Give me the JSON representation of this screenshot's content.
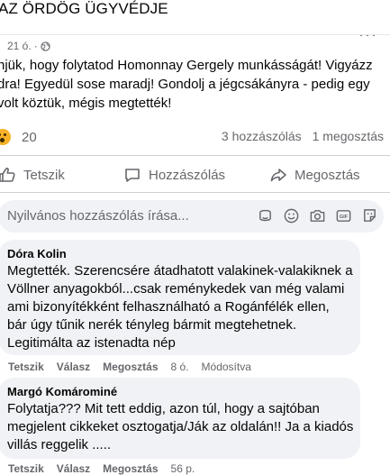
{
  "header": {
    "title": "AZ ÖRDÖG ÜGYVÉDJE",
    "more_icon": "more-dots-icon"
  },
  "post": {
    "time": "21 ó.",
    "audience_icon": "globe-icon",
    "text": "njük, hogy folytatod Homonnay Gergely munkásságát! Vigyázz\ndra! Egyedül sose    maradj! Gondolj a jégcsákányra - pedig egy\n volt köztük, mégis megtették!",
    "reactions": {
      "icon": "wow-emoji-icon",
      "count": "20"
    },
    "comments_count": "3 hozzászólás",
    "shares_count": "1 megosztás"
  },
  "actions": {
    "like": "Tetszik",
    "comment": "Hozzászólás",
    "share": "Megosztás"
  },
  "composer": {
    "placeholder": "Nyilvános hozzászólás írása...",
    "icons": [
      "avatar-sticker-icon",
      "emoji-icon",
      "camera-icon",
      "gif-icon",
      "sticker-icon"
    ]
  },
  "comments": [
    {
      "author": "Dóra Kolin",
      "text": "Megtették. Szerencsére átadhatott valakinek-valakiknek a\nVöllner anyagokból...csak reménykedek van még valami\nami bizonyítékként felhasználható a Rogánfélék ellen,\nbár úgy tűnik nerék tényleg bármit megtehetnek.\nLegitimálta az istenadta nép",
      "like": "Tetszik",
      "reply": "Válasz",
      "share": "Megosztás",
      "time": "8 ó.",
      "edited": "Módosítva"
    },
    {
      "author": "Margó Komárominé",
      "text": "Folytatja??? Mit tett eddig, azon túl, hogy a sajtóban\nmegjelent cikkeket osztogatja/Ják az oldalán!! Ja a kiadós\nvillás reggelik .....",
      "like": "Tetszik",
      "reply": "Válasz",
      "share": "Megosztás",
      "time": "56 p."
    }
  ]
}
